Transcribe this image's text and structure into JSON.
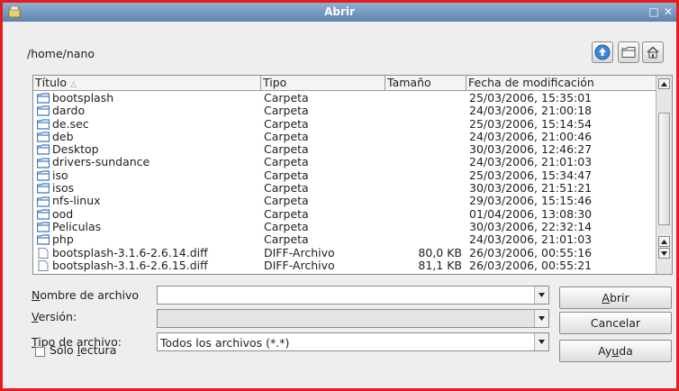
{
  "window": {
    "title": "Abrir"
  },
  "path": "/home/nano",
  "columns": {
    "name": "Título",
    "type": "Tipo",
    "size": "Tamaño",
    "date": "Fecha de modificación"
  },
  "files": [
    {
      "name": "bootsplash",
      "type": "Carpeta",
      "size": "",
      "date": "25/03/2006, 15:35:01",
      "kind": "folder"
    },
    {
      "name": "dardo",
      "type": "Carpeta",
      "size": "",
      "date": "24/03/2006, 21:00:18",
      "kind": "folder"
    },
    {
      "name": "de.sec",
      "type": "Carpeta",
      "size": "",
      "date": "25/03/2006, 15:14:54",
      "kind": "folder"
    },
    {
      "name": "deb",
      "type": "Carpeta",
      "size": "",
      "date": "24/03/2006, 21:00:46",
      "kind": "folder"
    },
    {
      "name": "Desktop",
      "type": "Carpeta",
      "size": "",
      "date": "30/03/2006, 12:46:27",
      "kind": "folder"
    },
    {
      "name": "drivers-sundance",
      "type": "Carpeta",
      "size": "",
      "date": "24/03/2006, 21:01:03",
      "kind": "folder"
    },
    {
      "name": "iso",
      "type": "Carpeta",
      "size": "",
      "date": "25/03/2006, 15:34:47",
      "kind": "folder"
    },
    {
      "name": "isos",
      "type": "Carpeta",
      "size": "",
      "date": "30/03/2006, 21:51:21",
      "kind": "folder"
    },
    {
      "name": "nfs-linux",
      "type": "Carpeta",
      "size": "",
      "date": "29/03/2006, 15:15:46",
      "kind": "folder"
    },
    {
      "name": "ood",
      "type": "Carpeta",
      "size": "",
      "date": "01/04/2006, 13:08:30",
      "kind": "folder"
    },
    {
      "name": "Peliculas",
      "type": "Carpeta",
      "size": "",
      "date": "30/03/2006, 22:32:14",
      "kind": "folder"
    },
    {
      "name": "php",
      "type": "Carpeta",
      "size": "",
      "date": "24/03/2006, 21:01:03",
      "kind": "folder"
    },
    {
      "name": "bootsplash-3.1.6-2.6.14.diff",
      "type": "DIFF-Archivo",
      "size": "80,0 KB",
      "date": "26/03/2006, 00:55:16",
      "kind": "file"
    },
    {
      "name": "bootsplash-3.1.6-2.6.15.diff",
      "type": "DIFF-Archivo",
      "size": "81,1 KB",
      "date": "26/03/2006, 00:55:21",
      "kind": "file"
    }
  ],
  "form": {
    "filename_label_u": "N",
    "filename_label_rest": "ombre de archivo",
    "filename_value": "",
    "version_label_u": "V",
    "version_label_rest": "ersión:",
    "version_value": "",
    "filetype_label_u": "T",
    "filetype_label_rest": "ipo de archivo:",
    "filetype_value": "Todos los archivos (*.*)",
    "readonly_label_pre": "Sólo ",
    "readonly_label_u": "l",
    "readonly_label_rest": "ectura",
    "readonly_checked": false
  },
  "buttons": {
    "open_u": "A",
    "open_rest": "brir",
    "cancel": "Cancelar",
    "help_pre": "Ay",
    "help_u": "u",
    "help_rest": "da"
  },
  "colors": {
    "frame": "#e41c1c",
    "titlebar": "#6f93bd",
    "folder": "#3e78c0"
  }
}
